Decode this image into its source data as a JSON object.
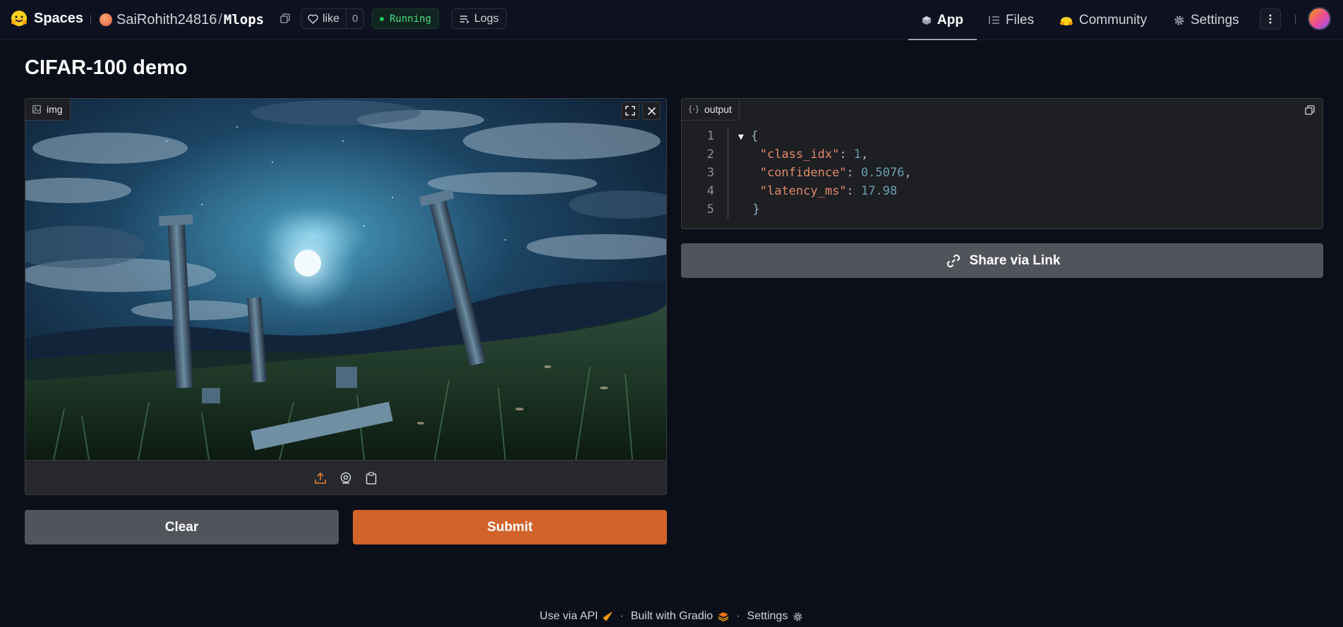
{
  "topbar": {
    "brand": "Spaces",
    "owner": "SaiRohith24816",
    "separator": "/",
    "repo": "Mlops",
    "like_label": "like",
    "like_count": "0",
    "status": "Running",
    "logs_label": "Logs",
    "nav": {
      "app": "App",
      "files": "Files",
      "community": "Community",
      "settings": "Settings"
    }
  },
  "main": {
    "title": "CIFAR-100 demo",
    "input_label": "img",
    "output_label": "output",
    "share_label": "Share via Link",
    "clear_label": "Clear",
    "submit_label": "Submit"
  },
  "output_json": {
    "line_numbers": [
      "1",
      "2",
      "3",
      "4",
      "5"
    ],
    "open_brace": "{",
    "close_brace": "}",
    "collapse_marker": "▼",
    "key_class_idx": "\"class_idx\"",
    "val_class_idx": "1",
    "key_confidence": "\"confidence\"",
    "val_confidence": "0.5076",
    "key_latency": "\"latency_ms\"",
    "val_latency": "17.98"
  },
  "footer": {
    "api": "Use via API",
    "built": "Built with Gradio",
    "settings": "Settings",
    "sep": "·"
  },
  "colors": {
    "background": "#0b0f19",
    "accent": "#d2632a",
    "secondary_button": "#52545c",
    "status_green": "#22c55e"
  },
  "icons": [
    "hugging-face-logo",
    "copy-icon",
    "heart-icon",
    "logs-icon",
    "app-cube-icon",
    "files-icon",
    "community-icon",
    "gear-icon",
    "more-icon",
    "image-icon",
    "fullscreen-icon",
    "close-icon",
    "upload-icon",
    "webcam-icon",
    "clipboard-icon",
    "json-icon",
    "link-icon",
    "rocket-icon",
    "gradio-logo"
  ]
}
